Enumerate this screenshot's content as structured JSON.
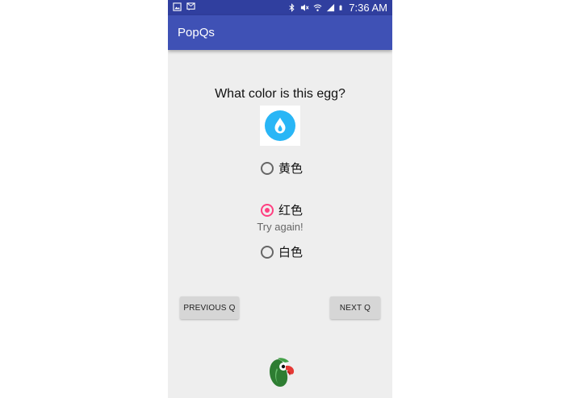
{
  "status_bar": {
    "time": "7:36 AM",
    "icons": [
      "picture-icon",
      "sms-icon",
      "bluetooth-icon",
      "mute-icon",
      "wifi-icon",
      "signal-icon",
      "battery-icon"
    ],
    "color": "#303f9f"
  },
  "app_bar": {
    "title": "PopQs",
    "color": "#3f51b5"
  },
  "quiz": {
    "question": "What color is this egg?",
    "image_icon": "blue-flame-icon",
    "options": [
      {
        "label": "黄色",
        "selected": false
      },
      {
        "label": "红色",
        "selected": true
      },
      {
        "label": "白色",
        "selected": false
      }
    ],
    "feedback": "Try again!",
    "accent": "#ff4081"
  },
  "nav": {
    "previous_label": "PREVIOUS Q",
    "next_label": "NEXT Q"
  },
  "footer": {
    "logo_icon": "parrot-icon"
  }
}
